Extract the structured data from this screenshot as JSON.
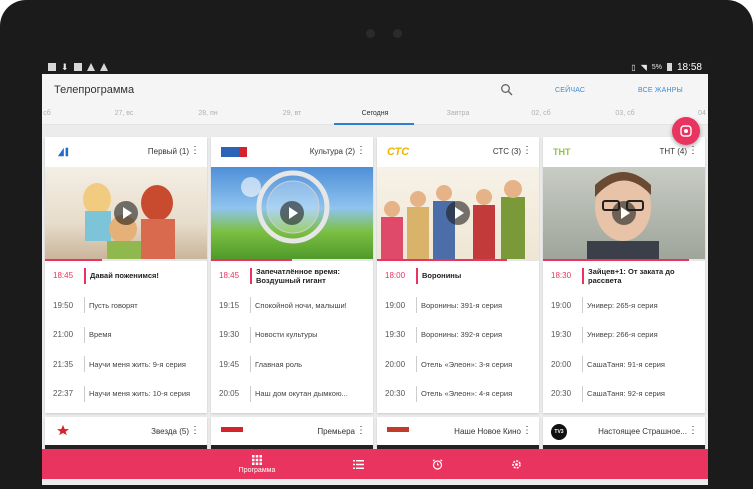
{
  "app": {
    "title": "Телепрограмма",
    "action_now": "СЕЙЧАС",
    "action_genres": "ВСЕ ЖАНРЫ"
  },
  "statusbar": {
    "battery": "5%",
    "time": "18:58"
  },
  "days": [
    "сб",
    "27, вс",
    "28, пн",
    "29, вт",
    "Сегодня",
    "Завтра",
    "02, сб",
    "03, сб",
    "04"
  ],
  "colors": {
    "accent": "#e8345f",
    "link": "#3b8ad8"
  },
  "channels": [
    {
      "name": "Первый (1)",
      "logo": "channel-one-logo",
      "progress": 0.35,
      "programs": [
        {
          "time": "18:45",
          "title": "Давай поженимся!",
          "now": true
        },
        {
          "time": "19:50",
          "title": "Пусть говорят"
        },
        {
          "time": "21:00",
          "title": "Время"
        },
        {
          "time": "21:35",
          "title": "Научи меня жить: 9-я серия"
        },
        {
          "time": "22:37",
          "title": "Научи меня жить: 10-я серия"
        }
      ]
    },
    {
      "name": "Культура (2)",
      "logo": "russia-k-logo",
      "progress": 0.5,
      "programs": [
        {
          "time": "18:45",
          "title": "Запечатлённое время: Воздушный гигант",
          "now": true
        },
        {
          "time": "19:15",
          "title": "Спокойной ночи, малыши!"
        },
        {
          "time": "19:30",
          "title": "Новости культуры"
        },
        {
          "time": "19:45",
          "title": "Главная роль"
        },
        {
          "time": "20:05",
          "title": "Наш дом окутан дымкою..."
        }
      ]
    },
    {
      "name": "СТС (3)",
      "logo": "ctc-logo",
      "logo_text": "СТС",
      "progress": 0.8,
      "programs": [
        {
          "time": "18:00",
          "title": "Воронины",
          "now": true
        },
        {
          "time": "19:00",
          "title": "Воронины: 391-я серия"
        },
        {
          "time": "19:30",
          "title": "Воронины: 392-я серия"
        },
        {
          "time": "20:00",
          "title": "Отель «Элеон»: 3-я серия"
        },
        {
          "time": "20:30",
          "title": "Отель «Элеон»: 4-я серия"
        }
      ]
    },
    {
      "name": "ТНТ (4)",
      "logo": "tnt-logo",
      "logo_text": "ТНТ",
      "progress": 0.9,
      "programs": [
        {
          "time": "18:30",
          "title": "Зайцев+1: От заката до рассвета",
          "now": true
        },
        {
          "time": "19:00",
          "title": "Универ: 265-я серия"
        },
        {
          "time": "19:30",
          "title": "Универ: 266-я серия"
        },
        {
          "time": "20:00",
          "title": "СашаТаня: 91-я серия"
        },
        {
          "time": "20:30",
          "title": "СашаТаня: 92-я серия"
        }
      ]
    }
  ],
  "channels_row2": [
    {
      "name": "Звезда (5)",
      "logo": "zvezda-logo"
    },
    {
      "name": "Премьера",
      "logo": "premiera-logo"
    },
    {
      "name": "Наше Новое Кино",
      "logo": "nashe-novoe-kino-logo"
    },
    {
      "name": "Настоящее Страшное...",
      "logo": "nastoyashchee-strashnoe-logo",
      "logo_text": "TV3"
    }
  ],
  "bottom_nav": [
    {
      "label": "Программа",
      "icon": "grid-icon",
      "active": true
    },
    {
      "label": "",
      "icon": "list-icon"
    },
    {
      "label": "",
      "icon": "alarm-icon"
    },
    {
      "label": "",
      "icon": "settings-icon"
    }
  ]
}
